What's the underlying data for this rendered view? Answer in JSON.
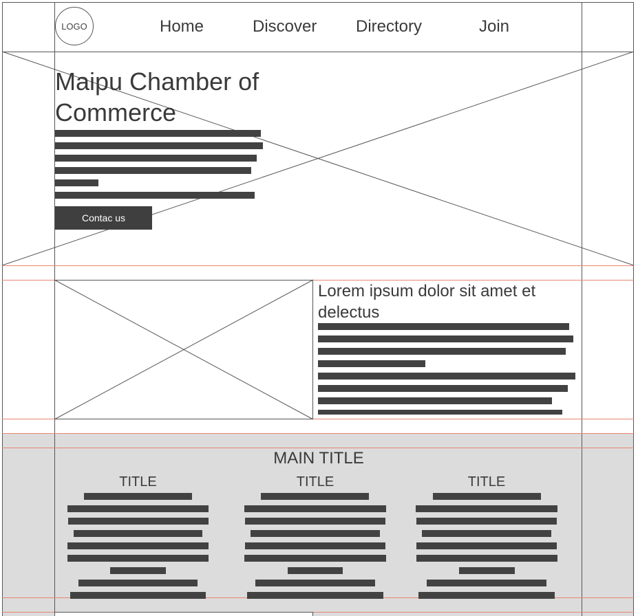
{
  "header": {
    "logo_label": "LOGO",
    "nav": [
      {
        "label": "Home"
      },
      {
        "label": "Discover"
      },
      {
        "label": "Directory"
      },
      {
        "label": "Join"
      }
    ]
  },
  "hero": {
    "title": "Maipu Chamber of Commerce",
    "button_label": "Contac us"
  },
  "feature": {
    "title": "Lorem ipsum dolor sit amet et delectus"
  },
  "services": {
    "main_title": "MAIN TITLE",
    "columns": [
      {
        "title": "TITLE"
      },
      {
        "title": "TITLE"
      },
      {
        "title": "TITLE"
      }
    ]
  },
  "colors": {
    "outline": "#555555",
    "guide": "#e8846f",
    "text_bar": "#424242",
    "section_bg": "#dcdcdc"
  }
}
